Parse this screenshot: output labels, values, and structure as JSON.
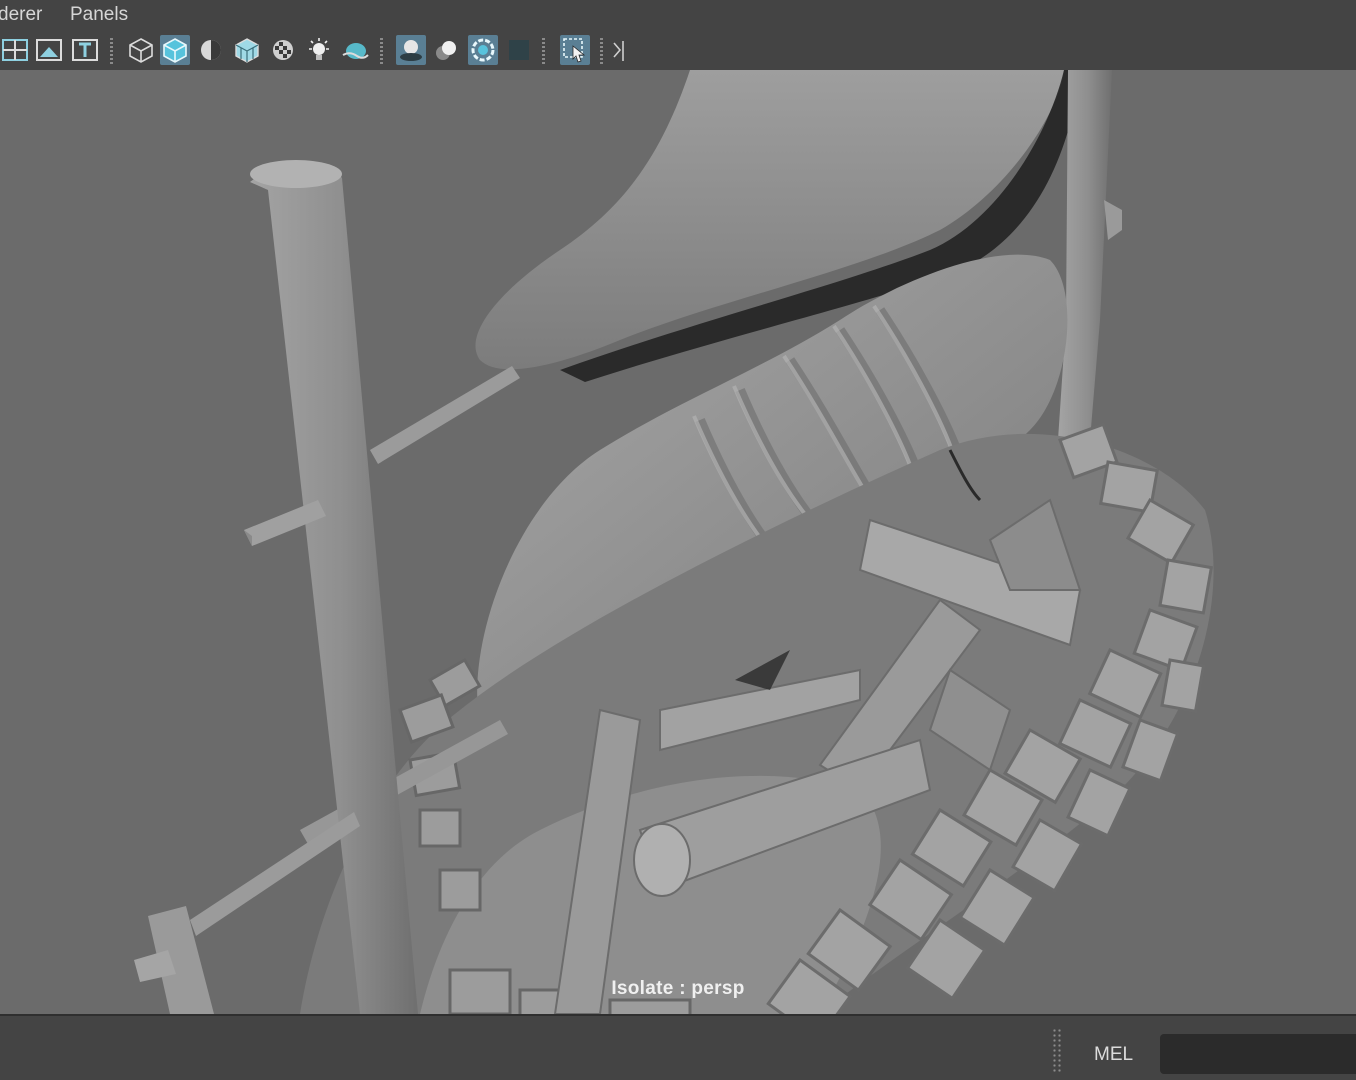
{
  "menubar": {
    "items": [
      "derer",
      "Panels"
    ]
  },
  "toolbar": {
    "icons": [
      "grid-view-icon",
      "image-plane-icon",
      "text-icon",
      "wireframe-cube-icon",
      "smooth-shade-cube-icon",
      "half-shaded-sphere-icon",
      "textured-cube-icon",
      "checker-icon",
      "light-bulb-icon",
      "fog-sphere-icon",
      "ambient-occlusion-icon",
      "motion-blur-icon",
      "anti-alias-icon",
      "dark-square-icon",
      "isolate-select-icon",
      "panel-layout-icon"
    ],
    "active_icons": [
      "smooth-shade-cube-icon",
      "ambient-occlusion-icon",
      "anti-alias-icon",
      "isolate-select-icon"
    ],
    "accent_color": "#5a7f94"
  },
  "viewport": {
    "camera_label": "Isolate : persp",
    "background_color": "#6b6b6b"
  },
  "statusbar": {
    "script_language": "MEL",
    "command_value": ""
  }
}
